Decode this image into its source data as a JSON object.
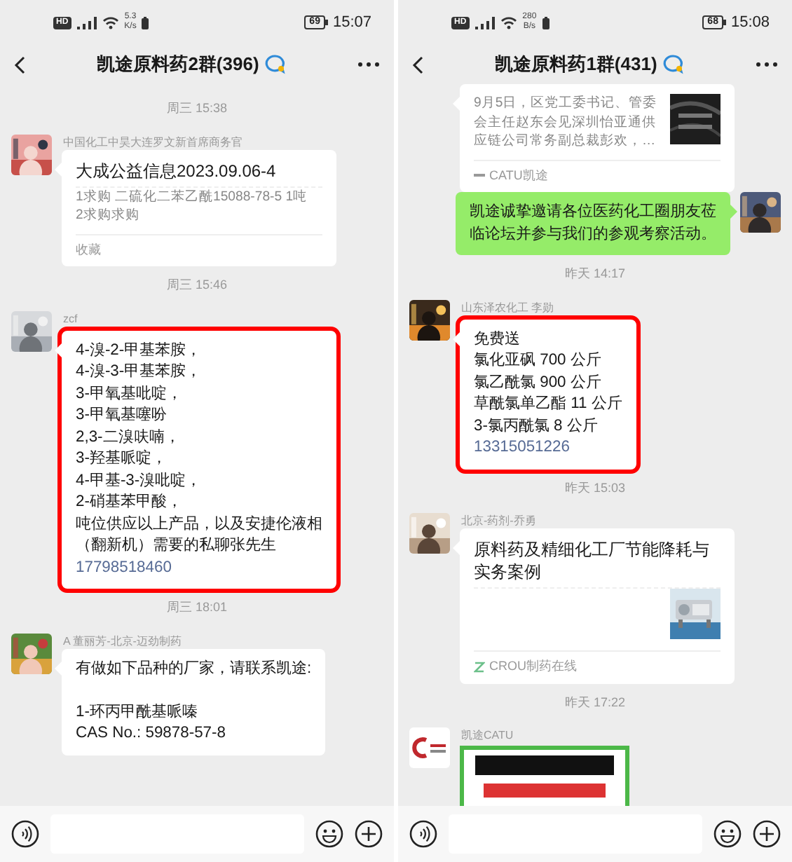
{
  "panels": [
    {
      "status": {
        "hd": "HD",
        "speed": "5.3",
        "speed_unit": "K/s",
        "battery": "69",
        "time": "15:07"
      },
      "title": "凯途原料药2群(396)",
      "messages": [
        {
          "kind": "time",
          "text": "周三 15:38"
        },
        {
          "kind": "card",
          "self": false,
          "sender": "中国化工中昊大连罗文新首席商务官",
          "title": "大成公益信息2023.09.06-4",
          "desc_lines": [
            "1求购 二硫化二苯乙酰15088-78-5 1吨",
            "2求购求购"
          ],
          "source": "收藏",
          "source_icon": false,
          "thumbnail": false
        },
        {
          "kind": "time",
          "text": "周三 15:46"
        },
        {
          "kind": "text",
          "self": false,
          "sender": "zcf",
          "highlighted": true,
          "blocks": [
            [
              "4-溴-2-甲基苯胺，",
              "4-溴-3-甲基苯胺，",
              "3-甲氧基吡啶，",
              "3-甲氧基噻吩",
              "2,3-二溴呋喃，",
              "3-羟基哌啶，",
              "4-甲基-3-溴吡啶，",
              "2-硝基苯甲酸，",
              "吨位供应以上产品，以及安捷伦液相（翻新机）需要的私聊张先生"
            ]
          ],
          "phone": "17798518460"
        },
        {
          "kind": "time",
          "text": "周三 18:01"
        },
        {
          "kind": "text",
          "self": false,
          "sender": "A 董丽芳-北京-迈劲制药",
          "highlighted": false,
          "blocks": [
            [
              "有做如下品种的厂家，请联系凯途:"
            ],
            [
              "1-环丙甲酰基哌嗪",
              "CAS No.: 59878-57-8"
            ]
          ]
        }
      ]
    },
    {
      "status": {
        "hd": "HD",
        "speed": "280",
        "speed_unit": "B/s",
        "battery": "68",
        "time": "15:08"
      },
      "title": "凯途原料药1群(431)",
      "messages": [
        {
          "kind": "card",
          "self": false,
          "sender_hidden": true,
          "desc_lines": [
            "9月5日，区党工委书记、管委会主任赵东会见深圳怡亚通供应链公司常务副总裁彭欢，…"
          ],
          "source": "CATU凯途",
          "source_icon": true,
          "thumbnail": true
        },
        {
          "kind": "text",
          "self": true,
          "highlighted": false,
          "blocks": [
            [
              "凯途诚挚邀请各位医药化工圈朋友莅临论坛并参与我们的参观考察活动。"
            ]
          ]
        },
        {
          "kind": "time",
          "text": "昨天 14:17"
        },
        {
          "kind": "text",
          "self": false,
          "sender": "山东泽农化工 李勋",
          "highlighted": true,
          "blocks": [
            [
              "免费送",
              "氯化亚砜 700 公斤",
              "氯乙酰氯 900 公斤",
              "草酰氯单乙酯 11 公斤",
              "3-氯丙酰氯 8 公斤"
            ]
          ],
          "phone": "13315051226"
        },
        {
          "kind": "time",
          "text": "昨天 15:03"
        },
        {
          "kind": "card",
          "self": false,
          "sender": "北京-药剂-乔勇",
          "title": "原料药及精细化工厂节能降耗与实务案例",
          "source": "CROU制药在线",
          "source_icon": true,
          "thumbnail": true
        },
        {
          "kind": "time",
          "text": "昨天 17:22"
        },
        {
          "self": false,
          "sender": "凯途CATU"
        }
      ]
    }
  ]
}
